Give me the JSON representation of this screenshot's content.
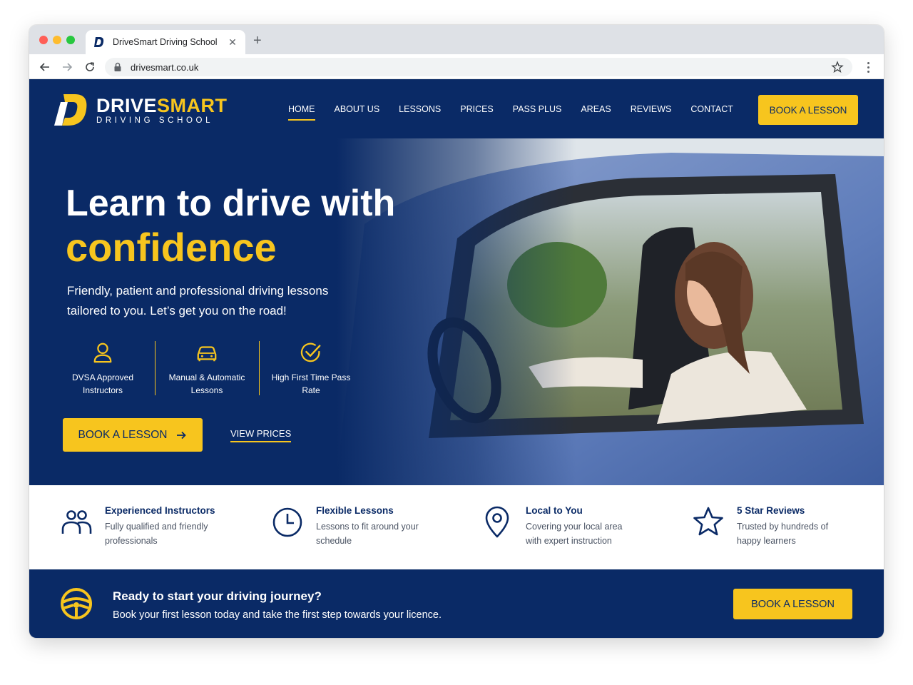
{
  "browser": {
    "tab_title": "DriveSmart Driving School",
    "url": "drivesmart.co.uk"
  },
  "brand": {
    "name_part1": "DRIVE",
    "name_part2": "SMART",
    "subtitle": "DRIVING SCHOOL",
    "primary_color": "#0a2a66",
    "accent_color": "#f7c51e"
  },
  "nav": {
    "items": [
      {
        "label": "HOME",
        "active": true
      },
      {
        "label": "ABOUT US"
      },
      {
        "label": "LESSONS"
      },
      {
        "label": "PRICES"
      },
      {
        "label": "PASS PLUS"
      },
      {
        "label": "AREAS"
      },
      {
        "label": "REVIEWS"
      },
      {
        "label": "CONTACT"
      }
    ],
    "cta_label": "BOOK A LESSON"
  },
  "hero": {
    "headline": "Learn to drive with",
    "headline_accent": "confidence",
    "subheading": "Friendly, patient and professional driving lessons tailored to you. Let’s get you on the road!",
    "features": [
      {
        "icon": "person-icon",
        "label": "DVSA Approved Instructors"
      },
      {
        "icon": "car-icon",
        "label": "Manual & Automatic Lessons"
      },
      {
        "icon": "check-circle-icon",
        "label": "High First Time Pass Rate"
      }
    ],
    "cta_label": "BOOK A LESSON",
    "secondary_label": "VIEW PRICES"
  },
  "benefits": [
    {
      "icon": "people-icon",
      "title": "Experienced Instructors",
      "desc": "Fully qualified and friendly professionals"
    },
    {
      "icon": "clock-icon",
      "title": "Flexible Lessons",
      "desc": "Lessons to fit around your schedule"
    },
    {
      "icon": "location-pin-icon",
      "title": "Local to You",
      "desc": "Covering your local area with expert instruction"
    },
    {
      "icon": "star-icon",
      "title": "5 Star Reviews",
      "desc": "Trusted by hundreds of happy learners"
    }
  ],
  "band": {
    "icon": "steering-wheel-icon",
    "title": "Ready to start your driving journey?",
    "subtitle": "Book your first lesson today and take the first step towards your licence.",
    "cta_label": "BOOK A LESSON"
  }
}
